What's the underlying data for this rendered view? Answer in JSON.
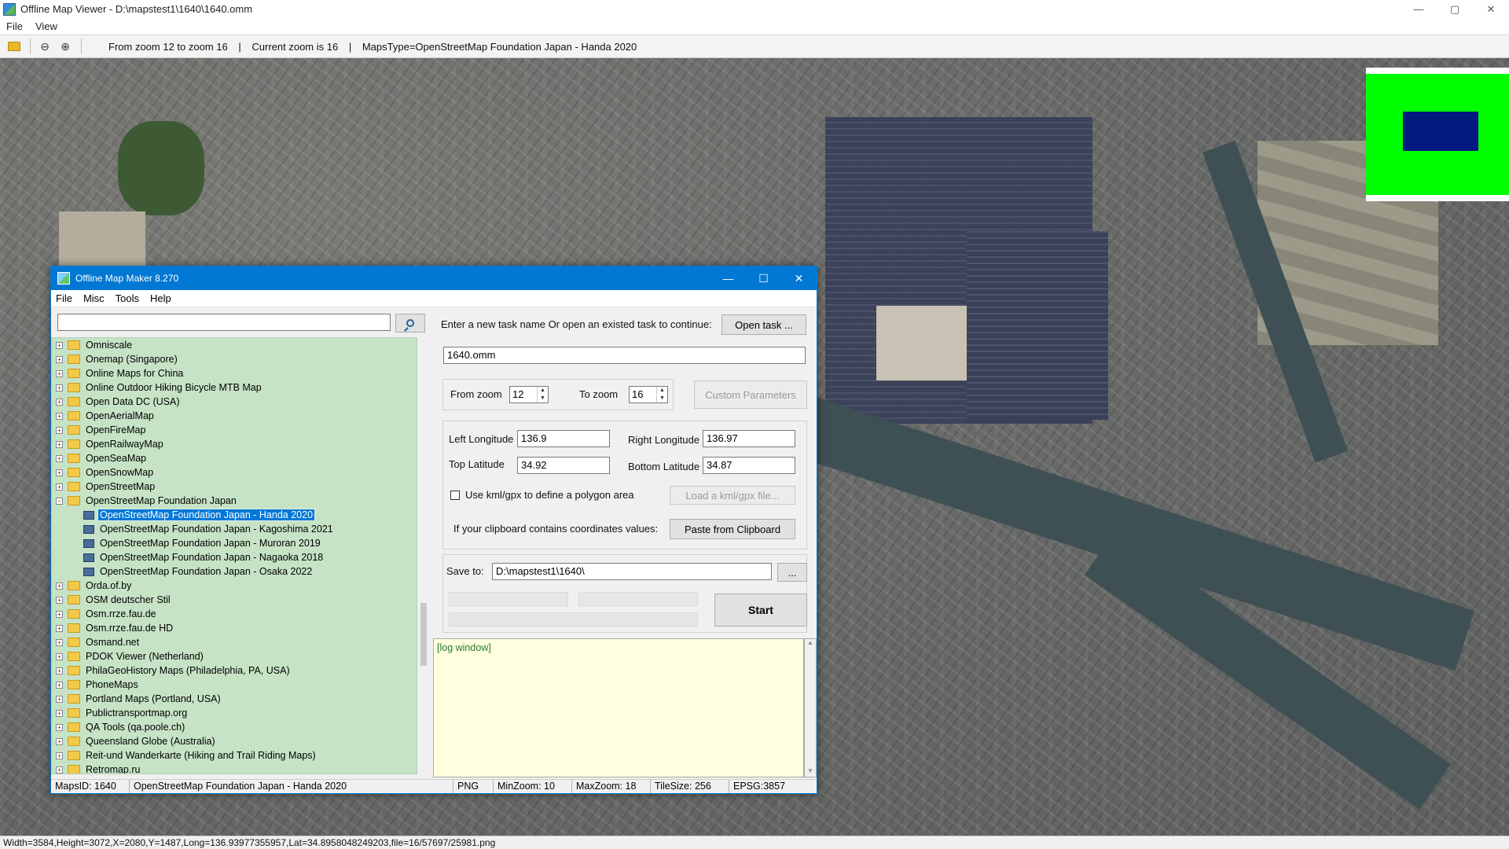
{
  "window": {
    "title": "Offline Map Viewer - D:\\mapstest1\\1640\\1640.omm",
    "controls": [
      "—",
      "▢",
      "✕"
    ]
  },
  "menu": [
    "File",
    "View"
  ],
  "toolbar": {
    "zoom_range": "From zoom 12 to zoom 16",
    "separator": "|",
    "current_zoom": "Current zoom is 16",
    "maps_type": "MapsType=OpenStreetMap Foundation Japan - Handa 2020",
    "zoom_out_glyph": "⊖",
    "zoom_in_glyph": "⊕"
  },
  "status_bar": {
    "text": "Width=3584,Height=3072,X=2080,Y=1487,Long=136.93977355957,Lat=34.8958048249203,file=16/57697/25981.png"
  },
  "colors": {
    "accent": "#0078d4",
    "tree_bg": "#c6e3c6",
    "log_bg": "#ffffe0",
    "overview_bg": "#00ff00",
    "overview_view": "#001a80"
  },
  "dialog": {
    "title": "Offline Map Maker 8.270",
    "controls": [
      "—",
      "☐",
      "✕"
    ],
    "menu": [
      "File",
      "Misc",
      "Tools",
      "Help"
    ],
    "search": {
      "value": "",
      "placeholder": ""
    },
    "tree": {
      "expander_closed": "+",
      "expander_open": "−",
      "items": [
        {
          "label": "Omniscale"
        },
        {
          "label": "Onemap (Singapore)"
        },
        {
          "label": "Online Maps for China"
        },
        {
          "label": "Online Outdoor Hiking Bicycle MTB Map"
        },
        {
          "label": "Open Data DC (USA)"
        },
        {
          "label": "OpenAerialMap"
        },
        {
          "label": "OpenFireMap"
        },
        {
          "label": "OpenRailwayMap"
        },
        {
          "label": "OpenSeaMap"
        },
        {
          "label": "OpenSnowMap"
        },
        {
          "label": "OpenStreetMap"
        },
        {
          "label": "OpenStreetMap Foundation Japan",
          "expanded": true
        },
        {
          "label": "OpenStreetMap Foundation Japan - Handa 2020",
          "child": true,
          "selected": true
        },
        {
          "label": "OpenStreetMap Foundation Japan - Kagoshima 2021",
          "child": true
        },
        {
          "label": "OpenStreetMap Foundation Japan - Muroran 2019",
          "child": true
        },
        {
          "label": "OpenStreetMap Foundation Japan - Nagaoka 2018",
          "child": true
        },
        {
          "label": "OpenStreetMap Foundation Japan - Osaka 2022",
          "child": true
        },
        {
          "label": "Orda.of.by"
        },
        {
          "label": "OSM deutscher Stil"
        },
        {
          "label": "Osm.rrze.fau.de"
        },
        {
          "label": "Osm.rrze.fau.de HD"
        },
        {
          "label": "Osmand.net"
        },
        {
          "label": "PDOK Viewer (Netherland)"
        },
        {
          "label": "PhilaGeoHistory Maps (Philadelphia, PA, USA)"
        },
        {
          "label": "PhoneMaps"
        },
        {
          "label": "Portland Maps (Portland, USA)"
        },
        {
          "label": "Publictransportmap.org"
        },
        {
          "label": "QA Tools (qa.poole.ch)"
        },
        {
          "label": "Queensland Globe (Australia)"
        },
        {
          "label": "Reit-und Wanderkarte (Hiking and Trail Riding Maps)"
        },
        {
          "label": "Retromap.ru"
        }
      ]
    },
    "task": {
      "prompt": "Enter a new task name Or open an existed task to continue:",
      "open_button": "Open task ...",
      "name_value": "1640.omm"
    },
    "zoom": {
      "from_label": "From zoom",
      "from_value": "12",
      "to_label": "To zoom",
      "to_value": "16",
      "custom_button": "Custom Parameters",
      "spin_up": "▲",
      "spin_down": "▼"
    },
    "coords": {
      "left_lon_label": "Left Longitude",
      "left_lon_value": "136.9",
      "right_lon_label": "Right Longitude",
      "right_lon_value": "136.97",
      "top_lat_label": "Top Latitude",
      "top_lat_value": "34.92",
      "bottom_lat_label": "Bottom Latitude",
      "bottom_lat_value": "34.87"
    },
    "polygon": {
      "checkbox_label": "Use kml/gpx to define a polygon area",
      "load_button": "Load a kml/gpx file..."
    },
    "clipboard": {
      "label": "If your clipboard contains coordinates values:",
      "button": "Paste from Clipboard"
    },
    "save": {
      "label": "Save to:",
      "value": "D:\\mapstest1\\1640\\",
      "browse_button": "..."
    },
    "start_button": "Start",
    "log": {
      "text": "[log window]",
      "scroll_up": "▲",
      "scroll_down": "▼"
    },
    "status": {
      "maps_id": "MapsID: 1640",
      "maps_name": "OpenStreetMap Foundation Japan - Handa 2020",
      "format": "PNG",
      "min_zoom": "MinZoom: 10",
      "max_zoom": "MaxZoom: 18",
      "tile_size": "TileSize: 256",
      "epsg": "EPSG:3857"
    }
  }
}
